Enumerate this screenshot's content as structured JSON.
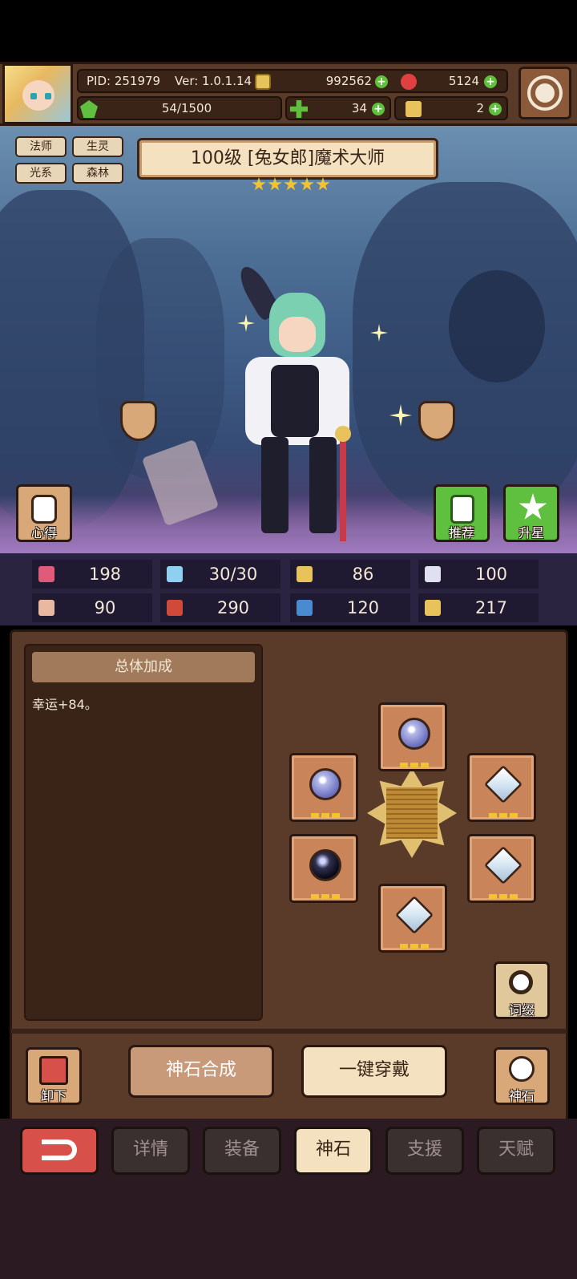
{
  "header": {
    "pid": "PID: 251979",
    "version": "Ver: 1.0.1.14",
    "gold": "992562",
    "gems": "5124",
    "energy": "54/1500",
    "clover": "34",
    "key": "2"
  },
  "tags": [
    "法师",
    "生灵",
    "光系",
    "森林"
  ],
  "character": {
    "title": "100级 [兔女郎]魔术大师",
    "stars": 5
  },
  "side_buttons": {
    "insight": "心得",
    "recommend": "推荐",
    "star_up": "升星"
  },
  "stats": [
    {
      "icon": "heart-icon",
      "value": "198",
      "color": "#e05a7a"
    },
    {
      "icon": "water-drop-icon",
      "value": "30/30",
      "color": "#8fd0f0"
    },
    {
      "icon": "shield-icon",
      "value": "86",
      "color": "#e8c25a"
    },
    {
      "icon": "wing-icon",
      "value": "100",
      "color": "#e0e0f0"
    },
    {
      "icon": "fist-icon",
      "value": "90",
      "color": "#e8b8a0"
    },
    {
      "icon": "spellbook-icon",
      "value": "290",
      "color": "#d04a3a"
    },
    {
      "icon": "boot-icon",
      "value": "120",
      "color": "#4a8ad0"
    },
    {
      "icon": "horseshoe-icon",
      "value": "217",
      "color": "#e8c25a"
    }
  ],
  "panel": {
    "header": "总体加成",
    "bonus": "幸运+84。",
    "affix_label": "词缀",
    "unequip_label": "卸下",
    "godstone_label": "神石",
    "synthesize_label": "神石合成",
    "equip_all_label": "一键穿戴"
  },
  "tabs": [
    "详情",
    "装备",
    "神石",
    "支援",
    "天赋"
  ],
  "active_tab": "神石",
  "colors": {
    "frame": "#5a3a28",
    "active_tab": "#f3e1c0",
    "back_button": "#d8504a"
  }
}
